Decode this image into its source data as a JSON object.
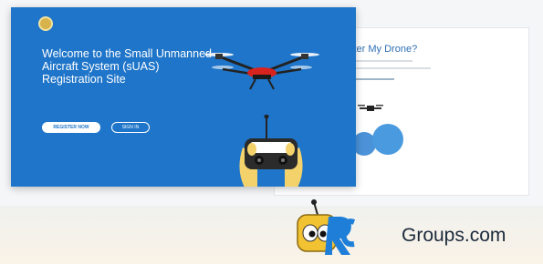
{
  "background_page": {
    "title": "ster My Drone?"
  },
  "hero": {
    "headline": "Welcome to the Small Unmanned Aircraft System (sUAS) Registration Site",
    "primary_button": "REGISTER NOW",
    "secondary_button": "SIGN IN"
  },
  "watermark": {
    "brand_text": "Groups.com"
  },
  "colors": {
    "hero_blue": "#1f75c9",
    "logo_yellow": "#f1c232",
    "logo_blue": "#1f7fd8",
    "drone_red": "#d8231e"
  }
}
